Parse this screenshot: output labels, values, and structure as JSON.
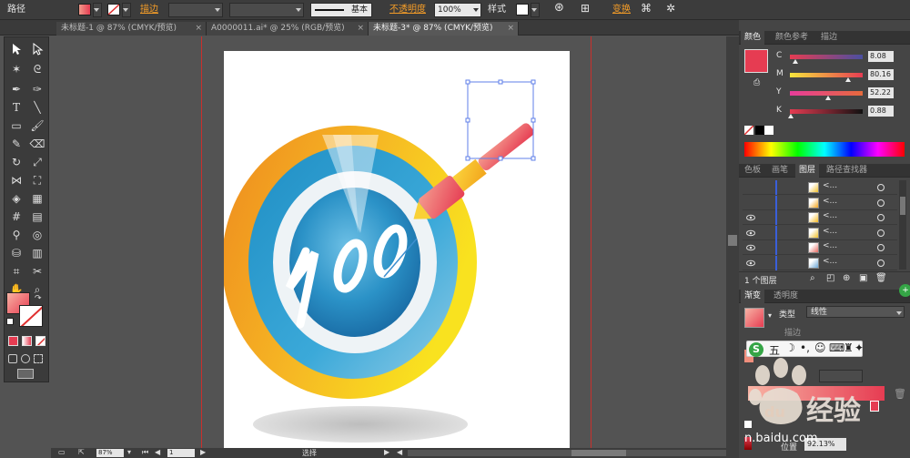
{
  "control_bar": {
    "object_type": "路径",
    "stroke_label": "描边",
    "stroke_style": "基本",
    "opacity_label": "不透明度",
    "opacity_value": "100%",
    "style_label": "样式",
    "transform_label": "变换"
  },
  "tabs": [
    {
      "label": "未标题-1 @ 87% (CMYK/预览)",
      "active": false
    },
    {
      "label": "A0000011.ai* @ 25% (RGB/预览)",
      "active": false
    },
    {
      "label": "未标题-3* @ 87% (CMYK/预览)",
      "active": true
    }
  ],
  "status": {
    "zoom": "87%",
    "page": "1",
    "tool": "选择"
  },
  "color_panel": {
    "tabs": [
      "颜色",
      "颜色参考",
      "描边"
    ],
    "channels": [
      {
        "label": "C",
        "value": "8.08",
        "pos": 0.08
      },
      {
        "label": "M",
        "value": "80.16",
        "pos": 0.8
      },
      {
        "label": "Y",
        "value": "52.22",
        "pos": 0.52
      },
      {
        "label": "K",
        "value": "0.88",
        "pos": 0.01
      }
    ],
    "fill_color": "#e63c52"
  },
  "layers_panel": {
    "tabs": [
      "色板",
      "画笔",
      "图层",
      "路径查找器"
    ],
    "rows": [
      {
        "name": "<...",
        "visible": false,
        "thumb": "#f2c029"
      },
      {
        "name": "<...",
        "visible": false,
        "thumb": "#f4a51e"
      },
      {
        "name": "<...",
        "visible": true,
        "thumb": "#f6b91f"
      },
      {
        "name": "<...",
        "visible": true,
        "thumb": "#f2c12a"
      },
      {
        "name": "<...",
        "visible": true,
        "thumb": "#e6685f"
      },
      {
        "name": "<...",
        "visible": true,
        "thumb": "#6ba6d6"
      }
    ],
    "footer": "1 个图层"
  },
  "gradient_panel": {
    "tabs": [
      "渐变",
      "透明度"
    ],
    "type_label": "类型",
    "type_value": "线性",
    "stroke_label": "描边",
    "position_label": "位置",
    "position_value": "92.13%"
  },
  "artwork": {
    "number_text": "100"
  },
  "watermark": {
    "text": "经验",
    "url": "n.baidu.com"
  },
  "ime": {
    "mode": "五"
  }
}
